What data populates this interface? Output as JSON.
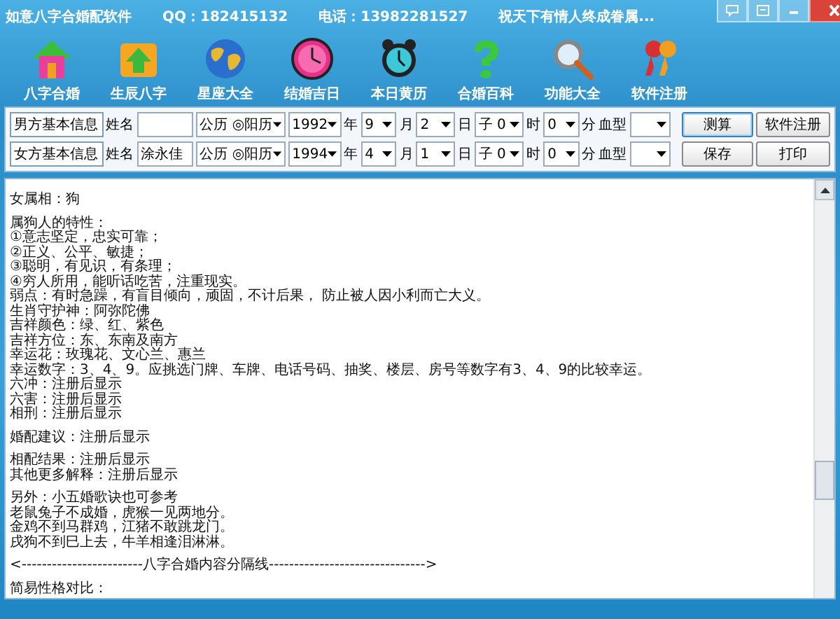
{
  "window": {
    "title": "如意八字合婚配软件",
    "qq": "QQ：182415132",
    "phone": "电话：13982281527",
    "slogan": "祝天下有情人终成眷属..."
  },
  "toolbar": [
    {
      "kind": "house",
      "label": "八字合婚"
    },
    {
      "kind": "upload",
      "label": "生辰八字"
    },
    {
      "kind": "globe",
      "label": "星座大全"
    },
    {
      "kind": "clock",
      "label": "结婚吉日"
    },
    {
      "kind": "alarm",
      "label": "本日黄历"
    },
    {
      "kind": "question",
      "label": "合婚百科"
    },
    {
      "kind": "search",
      "label": "功能大全"
    },
    {
      "kind": "keys",
      "label": "软件注册"
    }
  ],
  "form": {
    "rows": [
      {
        "items": [
          {
            "kind": "label_box",
            "text": "男方基本信息"
          },
          {
            "kind": "text",
            "text": "姓名"
          },
          {
            "kind": "input"
          },
          {
            "kind": "select",
            "value": "公历 ◎阳历"
          },
          {
            "kind": "select",
            "value": "1992"
          },
          {
            "kind": "text",
            "text": "年"
          },
          {
            "kind": "select",
            "value": "9"
          },
          {
            "kind": "text",
            "text": "月"
          },
          {
            "kind": "select",
            "value": "2"
          },
          {
            "kind": "text",
            "text": "日"
          },
          {
            "kind": "select",
            "value": "子 0"
          },
          {
            "kind": "text",
            "text": "时"
          },
          {
            "kind": "select",
            "value": "0"
          },
          {
            "kind": "text",
            "text": "分"
          },
          {
            "kind": "text",
            "text": "血型"
          },
          {
            "kind": "select"
          },
          {
            "kind": "button",
            "label": "测算",
            "focused": true
          },
          {
            "kind": "button",
            "label": "软件注册",
            "focused": false
          }
        ]
      },
      {
        "items": [
          {
            "kind": "label_box",
            "text": "女方基本信息"
          },
          {
            "kind": "text",
            "text": "姓名"
          },
          {
            "kind": "input",
            "value": "涂永佳"
          },
          {
            "kind": "select",
            "value": "公历 ◎阳历"
          },
          {
            "kind": "select",
            "value": "1994"
          },
          {
            "kind": "text",
            "text": "年"
          },
          {
            "kind": "select",
            "value": "4"
          },
          {
            "kind": "text",
            "text": "月"
          },
          {
            "kind": "select",
            "value": "1"
          },
          {
            "kind": "text",
            "text": "日"
          },
          {
            "kind": "select",
            "value": "子 0"
          },
          {
            "kind": "text",
            "text": "时"
          },
          {
            "kind": "select",
            "value": "0"
          },
          {
            "kind": "text",
            "text": "分"
          },
          {
            "kind": "text",
            "text": "血型"
          },
          {
            "kind": "select"
          },
          {
            "kind": "button",
            "label": "保存",
            "focused": false
          },
          {
            "kind": "button",
            "label": "打印",
            "focused": false
          }
        ]
      }
    ]
  },
  "content": {
    "paragraphs": [
      [
        "女属相：狗"
      ],
      [
        "属狗人的特性：",
        "①意志坚定，忠实可靠；",
        "②正义、公平、敏捷；",
        "③聪明，有见识，有条理；",
        "④穷人所用，能听话吃苦，注重现实。",
        "弱点：有时急躁，有盲目倾向，顽固，不计后果， 防止被人因小利而亡大义。",
        "生肖守护神：阿弥陀佛",
        "吉祥颜色：绿、红、紫色",
        "吉祥方位：东、东南及南方",
        "幸运花：玫瑰花、文心兰、惠兰",
        "幸运数字：3、4、9。应挑选门牌、车牌、电话号码、抽奖、楼层、房号等数字有3、4、9的比较幸运。",
        "六冲：注册后显示",
        "六害：注册后显示",
        "相刑：注册后显示"
      ],
      [
        "婚配建议：注册后显示"
      ],
      [
        "相配结果：注册后显示",
        "其他更多解释：注册后显示"
      ],
      [
        "另外：小五婚歌诀也可参考",
        "老鼠兔子不成婚，虎猴一见两地分。",
        "金鸡不到马群鸡，江猪不敢跳龙门。",
        "戌狗不到巳上去，牛羊相逢泪淋淋。"
      ],
      [
        "<------------------------八字合婚内容分隔线------------------------------->"
      ],
      [
        "简易性格对比："
      ]
    ]
  }
}
